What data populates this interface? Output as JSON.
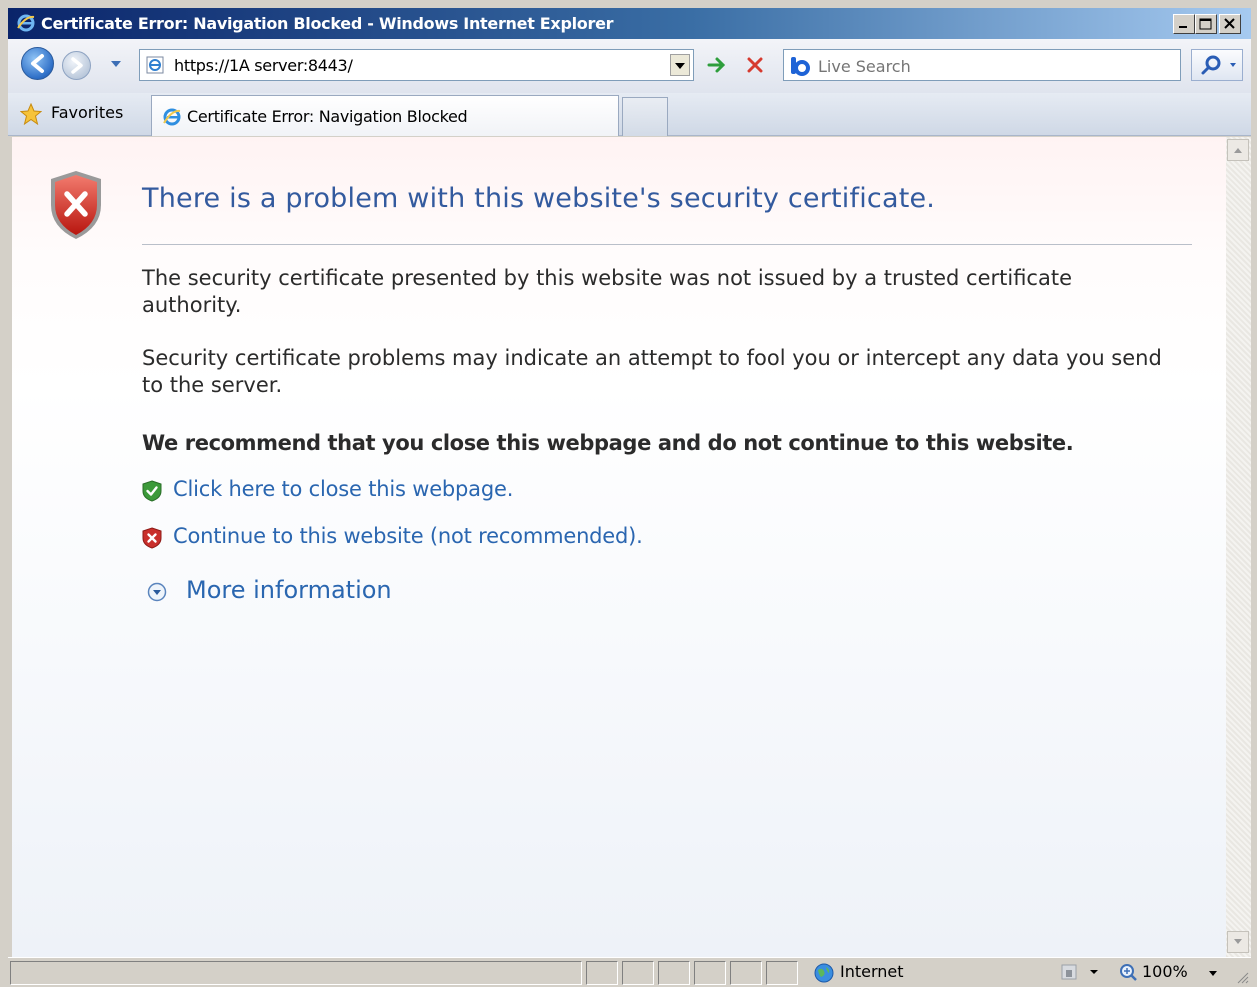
{
  "window": {
    "title": "Certificate Error: Navigation Blocked - Windows Internet Explorer"
  },
  "address_bar": {
    "url": "https://1A server:8443/"
  },
  "search": {
    "placeholder": "Live Search"
  },
  "favorites": {
    "label": "Favorites"
  },
  "tab": {
    "label": "Certificate Error: Navigation Blocked"
  },
  "content": {
    "headline": "There is a problem with this website's security certificate.",
    "paragraph1": "The security certificate presented by this website was not issued by a trusted certificate authority.",
    "paragraph2": "Security certificate problems may indicate an attempt to fool you or intercept any data you send to the server.",
    "recommendation": "We recommend that you close this webpage and do not continue to this website.",
    "close_link": "Click here to close this webpage.",
    "continue_link": "Continue to this website (not recommended).",
    "more_info": "More information"
  },
  "status_bar": {
    "zone": "Internet",
    "zoom": "100%"
  },
  "colors": {
    "link": "#2a66b0",
    "headline": "#335a9e",
    "title_bar": "#0a246a"
  }
}
